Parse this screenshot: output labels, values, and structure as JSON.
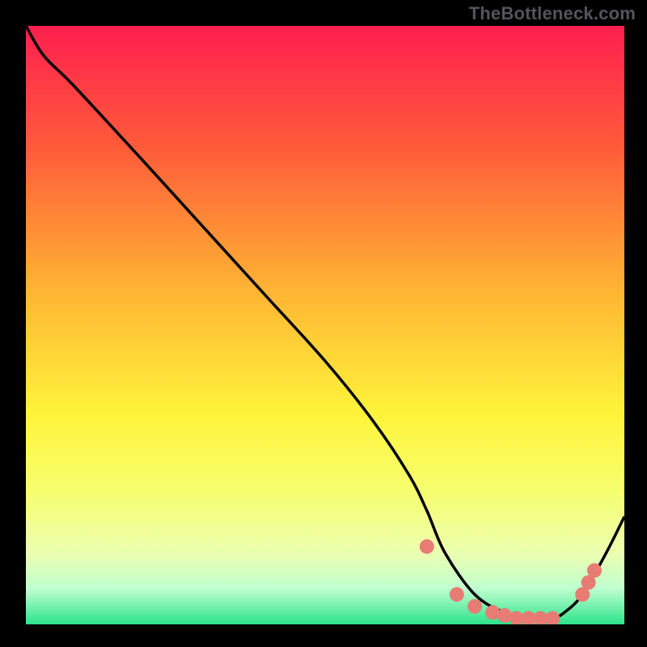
{
  "attribution": "TheBottleneck.com",
  "chart_data": {
    "type": "line",
    "title": "",
    "xlabel": "",
    "ylabel": "",
    "xlim": [
      0,
      100
    ],
    "ylim": [
      0,
      100
    ],
    "grid": false,
    "legend": false,
    "curve": {
      "name": "bottleneck-curve",
      "x": [
        0,
        3,
        8,
        20,
        30,
        40,
        50,
        58,
        64,
        67,
        70,
        75,
        80,
        85,
        88,
        90,
        93,
        97,
        100
      ],
      "y": [
        100,
        95,
        90,
        77,
        66,
        55,
        44,
        34,
        25,
        19,
        12,
        5,
        2,
        1,
        1,
        2,
        5,
        12,
        18
      ]
    },
    "marked_points": {
      "name": "highlight-dots",
      "color": "#e97b75",
      "x": [
        67,
        72,
        75,
        78,
        80,
        82,
        84,
        86,
        88,
        93,
        94,
        95
      ],
      "y": [
        13,
        5,
        3,
        2,
        1.5,
        1,
        1,
        1,
        1,
        5,
        7,
        9
      ]
    },
    "gradient_stops": [
      {
        "offset": 0,
        "color": "#ff1f4f"
      },
      {
        "offset": 20,
        "color": "#ff5a3a"
      },
      {
        "offset": 45,
        "color": "#ffb733"
      },
      {
        "offset": 65,
        "color": "#fff43b"
      },
      {
        "offset": 78,
        "color": "#f6ff70"
      },
      {
        "offset": 88,
        "color": "#ecffb0"
      },
      {
        "offset": 94,
        "color": "#c0ffcf"
      },
      {
        "offset": 100,
        "color": "#2de38b"
      }
    ],
    "annotations": []
  }
}
